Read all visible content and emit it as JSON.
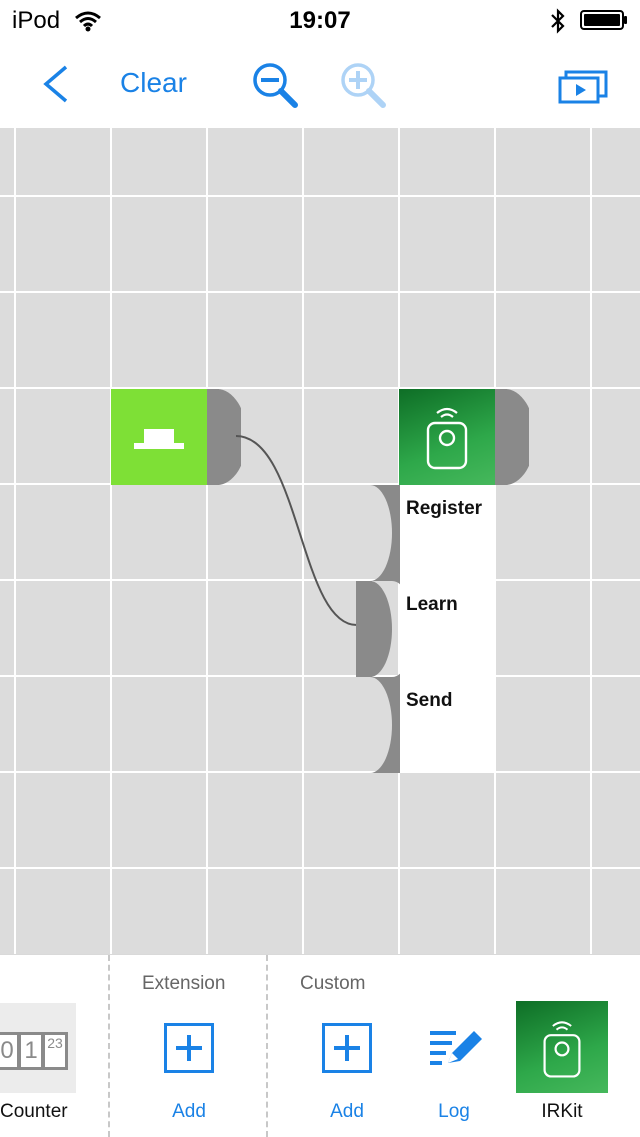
{
  "status_bar": {
    "carrier": "iPod",
    "time": "19:07"
  },
  "nav_bar": {
    "clear_label": "Clear",
    "icons": [
      "back-chevron-icon",
      "zoom-out-icon",
      "zoom-in-icon",
      "slideshow-icon"
    ]
  },
  "canvas": {
    "irkit_node": {
      "ports": [
        "Register",
        "Learn",
        "Send"
      ]
    },
    "button_node": {
      "icon": "push-button-icon"
    }
  },
  "toolbar": {
    "counter": {
      "label": "Counter",
      "digits": [
        "0",
        "1",
        "23"
      ]
    },
    "extension": {
      "title": "Extension",
      "add_label": "Add"
    },
    "custom": {
      "title": "Custom",
      "add_label": "Add",
      "log_label": "Log",
      "irkit_label": "IRKit"
    }
  },
  "colors": {
    "accent": "#1a82e6",
    "grid_bg": "#dcdcdc",
    "button_node": "#7ee036",
    "irkit_green": "#2ea84a",
    "port_gray": "#8a8a8a"
  }
}
